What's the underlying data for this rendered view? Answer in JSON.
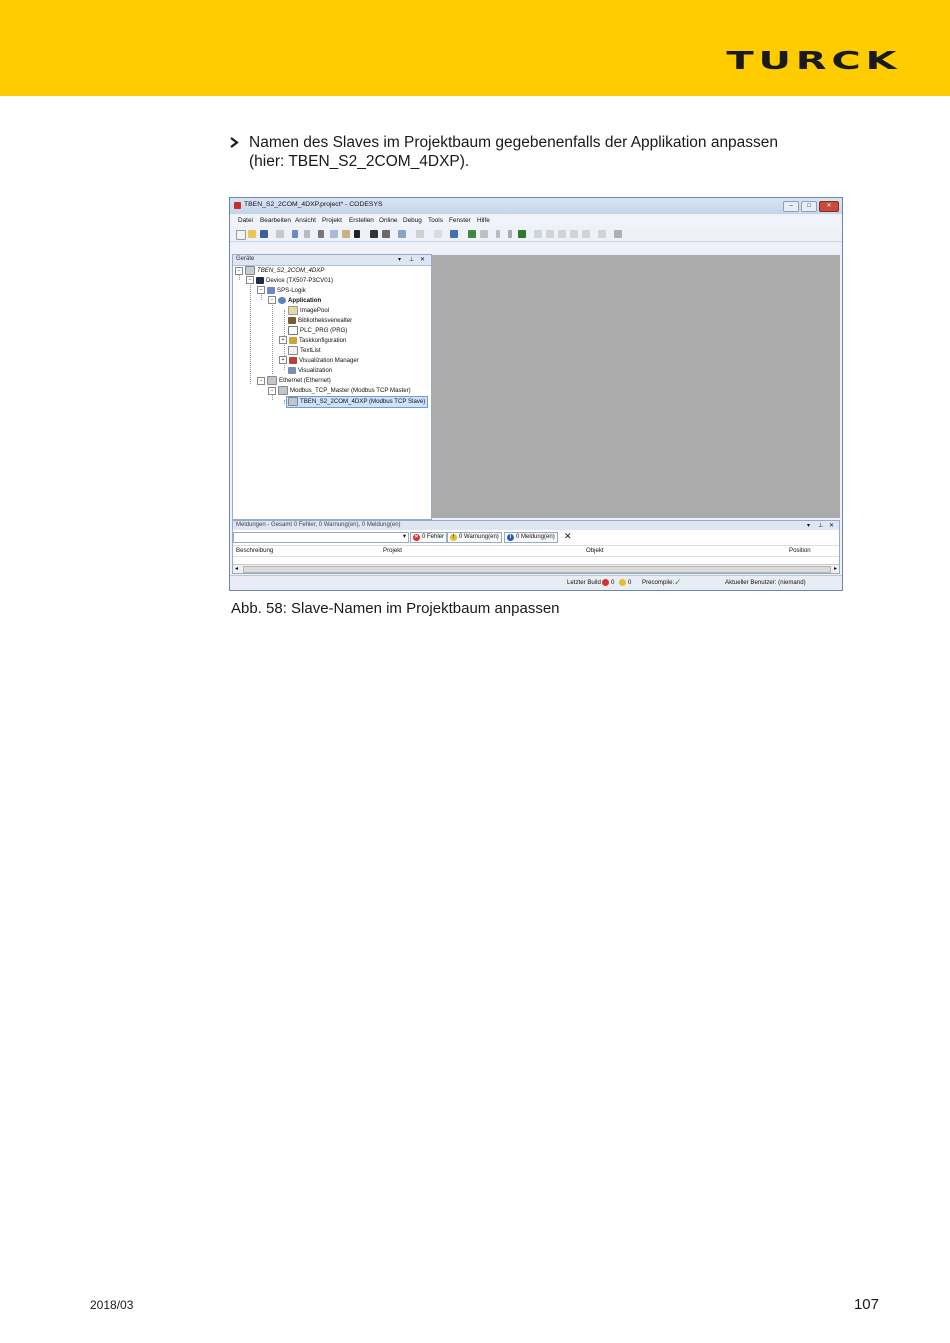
{
  "header": {
    "brand": "TURCK",
    "band_color": "#ffcc00"
  },
  "bullet": {
    "line1": "Namen des Slaves im Projektbaum gegebenenfalls der Applikation anpassen",
    "line2": "(hier: TBEN_S2_2COM_4DXP)."
  },
  "screenshot": {
    "window_title": "TBEN_S2_2COM_4DXP.project* - CODESYS",
    "window_buttons": [
      "–",
      "□",
      "✕"
    ],
    "menu": [
      "Datei",
      "Bearbeiten",
      "Ansicht",
      "Projekt",
      "Erstellen",
      "Online",
      "Debug",
      "Tools",
      "Fenster",
      "Hilfe"
    ],
    "devices_panel": {
      "title": "Geräte",
      "tree": [
        "TBEN_S2_2COM_4DXP",
        "Device (TX507-P3CV01)",
        "SPS-Logik",
        "Application",
        "ImagePool",
        "Bibliotheksverwalter",
        "PLC_PRG (PRG)",
        "Taskkonfiguration",
        "TextList",
        "Visualization Manager",
        "Visualization",
        "Ethernet (Ethernet)",
        "Modbus_TCP_Master (Modbus TCP Master)",
        "TBEN_S2_2COM_4DXP (Modbus TCP Slave)"
      ]
    },
    "messages_panel": {
      "title": "Meldungen - Gesamt 0 Fehler, 0 Warnung(en), 0 Meldung(en)",
      "errors": "0 Fehler",
      "warnings": "0 Warnung(en)",
      "infos": "0 Meldung(en)",
      "columns": [
        "Beschreibung",
        "Projekt",
        "Objekt",
        "Position"
      ]
    },
    "statusbar": {
      "last_build_label": "Letzter Build",
      "errors_count": "0",
      "warnings_count": "0",
      "precompile_label": "Precompile:",
      "user": "Aktueller Benutzer: (niemand)"
    }
  },
  "caption": "Abb. 58: Slave-Namen im Projektbaum anpassen",
  "footer": {
    "date": "2018/03",
    "page": "107"
  }
}
